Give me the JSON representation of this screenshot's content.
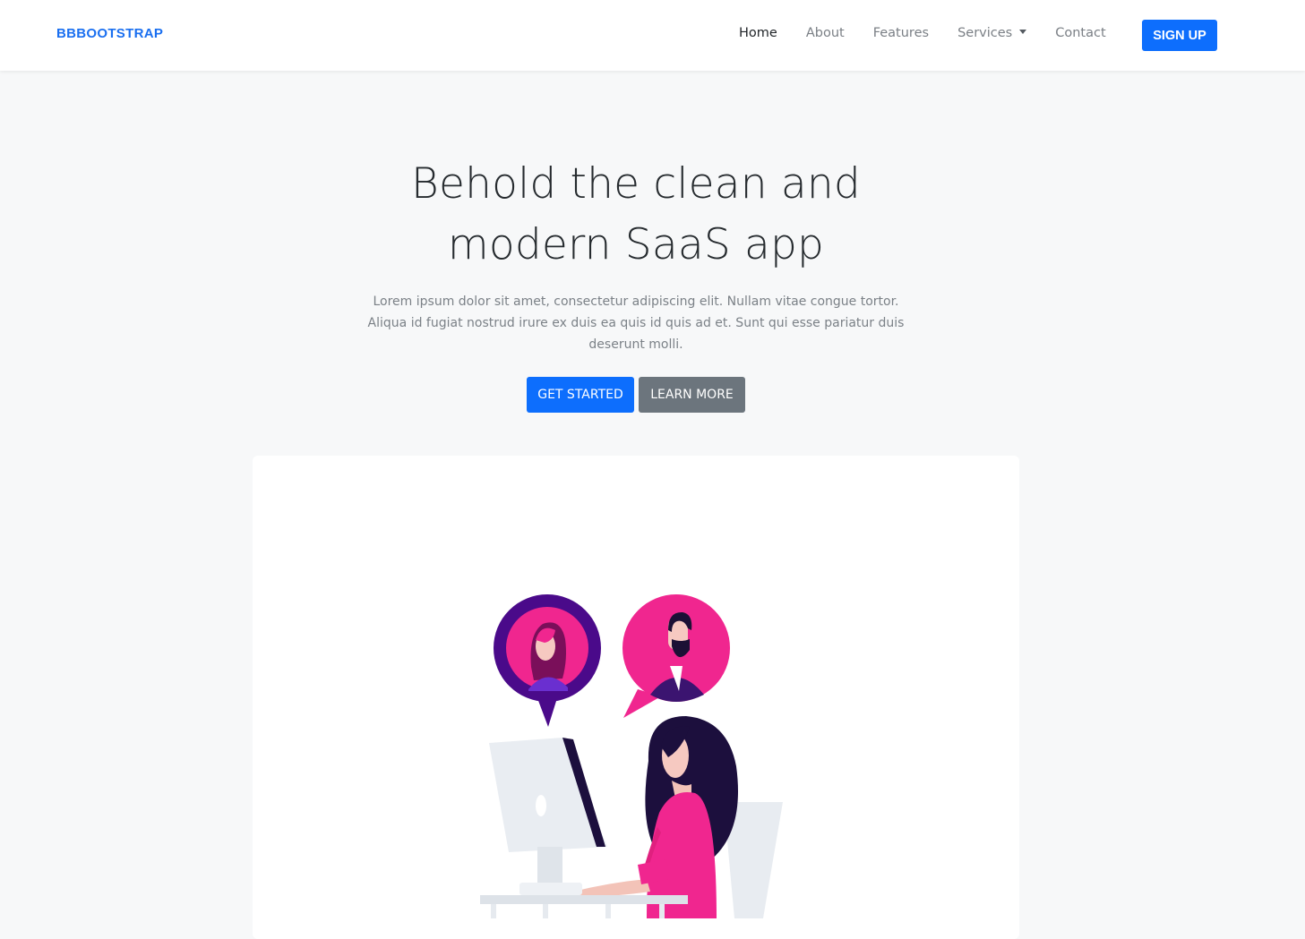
{
  "navbar": {
    "brand": "BBBOOTSTRAP",
    "links": [
      {
        "label": "Home",
        "active": true
      },
      {
        "label": "About",
        "active": false
      },
      {
        "label": "Features",
        "active": false
      },
      {
        "label": "Services",
        "active": false,
        "dropdown": true
      },
      {
        "label": "Contact",
        "active": false
      }
    ],
    "signup_label": "SIGN UP"
  },
  "hero": {
    "title_line1": "Behold the clean and",
    "title_line2": "modern SaaS app",
    "text_line1": "Lorem ipsum dolor sit amet, consectetur adipiscing elit. Nullam vitae congue tortor.",
    "text_line2": "Aliqua id fugiat nostrud irure ex duis ea quis id quis ad et. Sunt qui esse pariatur duis",
    "text_line3": "deserunt molli.",
    "primary_button": "GET STARTED",
    "secondary_button": "LEARN MORE"
  },
  "colors": {
    "brand": "#1a6ff0",
    "primary": "#0d6efd",
    "secondary": "#6c757d",
    "accent_pink": "#f0268f",
    "accent_purple": "#4a0a8a"
  },
  "illustration": {
    "icon": "video-chat-illustration"
  }
}
